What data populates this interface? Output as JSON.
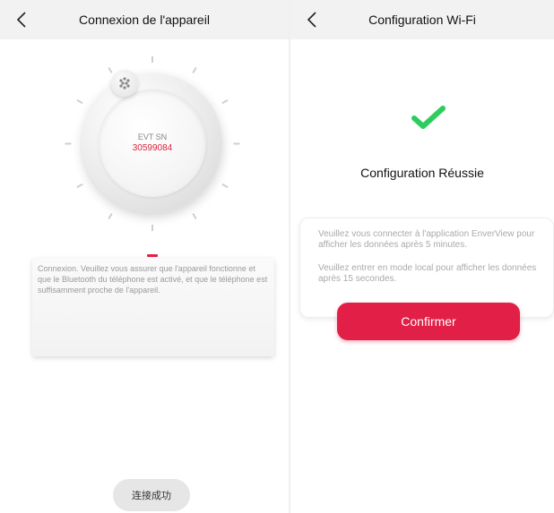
{
  "left": {
    "title": "Connexion de l'appareil",
    "back_icon": "chevron-left-icon",
    "device": {
      "label": "EVT SN",
      "serial": "30599084"
    },
    "message": "Connexion. Veuillez vous assurer que l'appareil fonctionne et que le Bluetooth du téléphone est activé, et que le téléphone est suffisamment proche de l'appareil.",
    "toast": "连接成功"
  },
  "right": {
    "title": "Configuration Wi-Fi",
    "back_icon": "chevron-left-icon",
    "status": "Configuration Réussie",
    "info_line1": "Veuillez vous connecter à l'application EnverView pour afficher les données après 5 minutes.",
    "info_line2": "Veuillez entrer en mode local pour afficher les données après 15 secondes.",
    "confirm_label": "Confirmer"
  },
  "colors": {
    "accent": "#e21f47",
    "success": "#2ecc5e",
    "serial": "#d9253e"
  }
}
